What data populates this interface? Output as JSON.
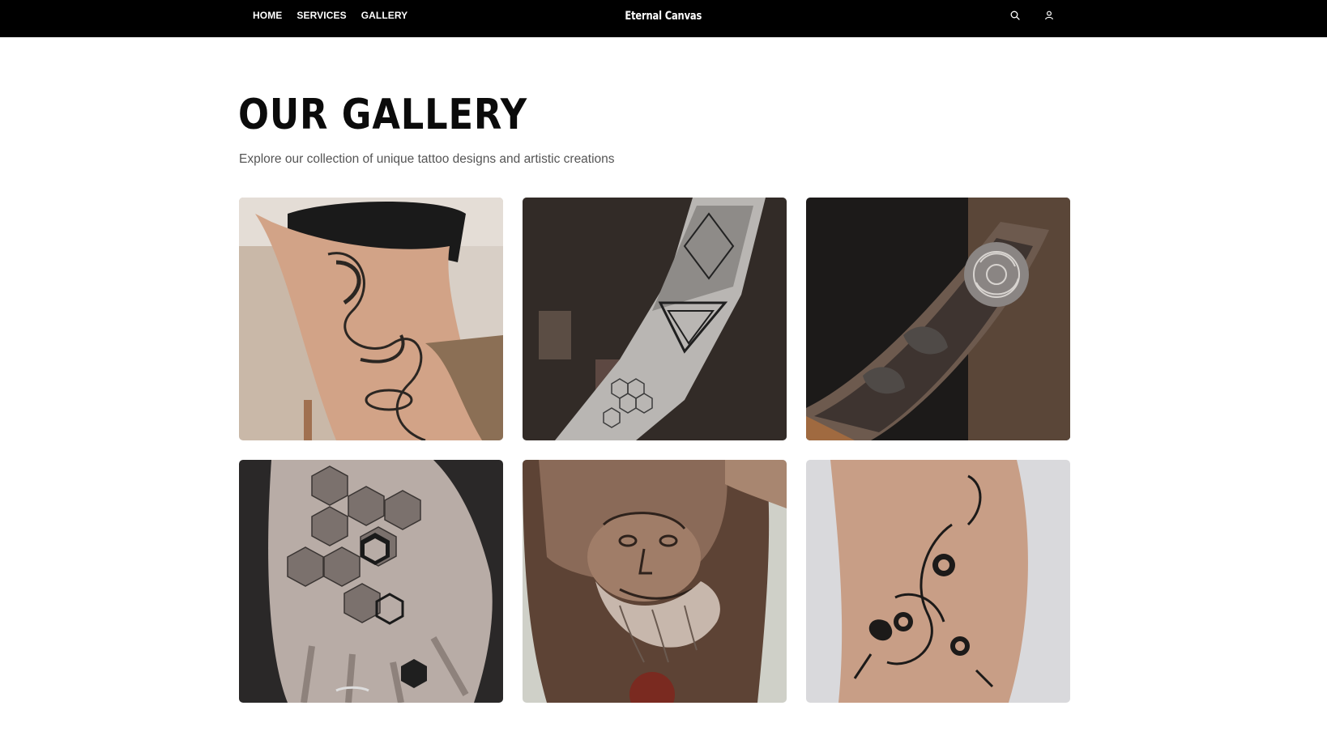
{
  "nav": {
    "links": [
      "HOME",
      "SERVICES",
      "GALLERY"
    ],
    "brand": "Eternal Canvas",
    "icons": [
      "search-icon",
      "user-icon"
    ]
  },
  "main": {
    "title": "OUR GALLERY",
    "subtitle": "Explore our collection of unique tattoo designs and artistic creations"
  },
  "gallery": {
    "items": [
      {
        "icon": "dragon-thigh-tattoo-image"
      },
      {
        "icon": "geometric-forearm-tattoo-image"
      },
      {
        "icon": "rose-forearm-tattoo-image"
      },
      {
        "icon": "hexagon-hand-tattoo-image"
      },
      {
        "icon": "bearded-god-portrait-tattoo-image"
      },
      {
        "icon": "tiger-leg-tattoo-image"
      }
    ]
  },
  "colors": {
    "navbar": "#000000",
    "background": "#ffffff",
    "title": "#0b0b0b",
    "subtitle": "#555555"
  }
}
